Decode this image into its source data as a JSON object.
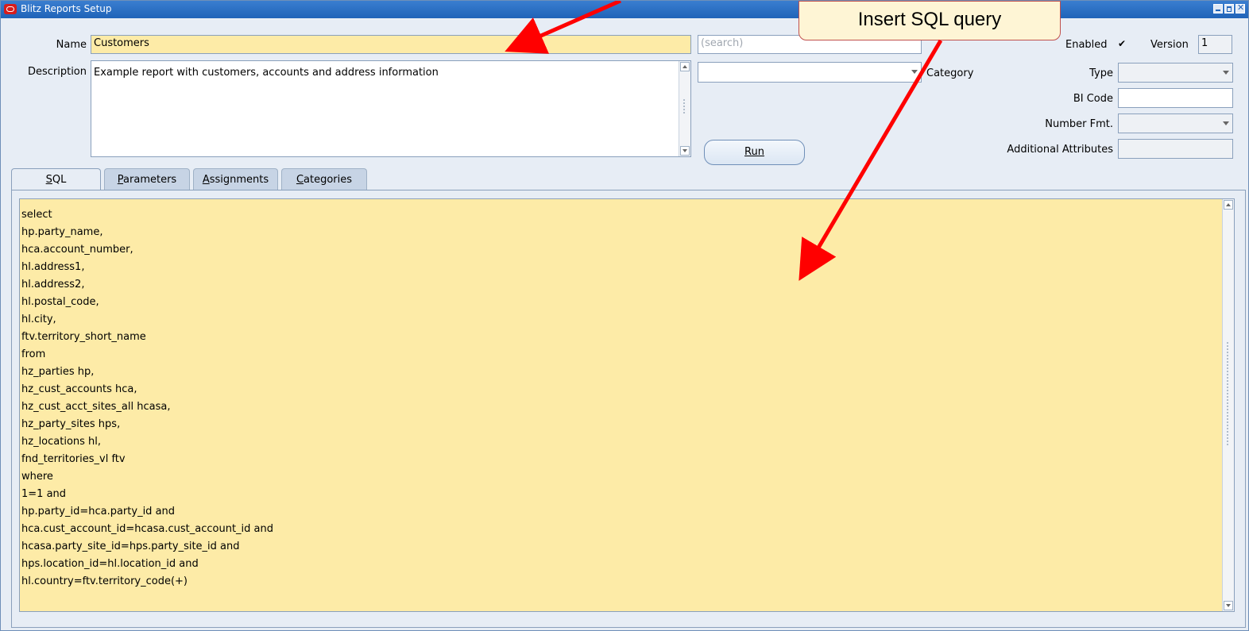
{
  "window": {
    "title": "Blitz Reports Setup",
    "icon": "oracle-app-icon",
    "controls": [
      "minimize-icon",
      "maximize-icon",
      "close-icon"
    ]
  },
  "form": {
    "name_label": "Name",
    "name_value": "Customers",
    "search_placeholder": "(search)",
    "description_label": "Description",
    "description_value": "Example report with customers, accounts and address information",
    "category_label": "Category",
    "category_value": "",
    "enabled_label": "Enabled",
    "enabled_checked": "✔",
    "version_label": "Version",
    "version_value": "1",
    "type_label": "Type",
    "type_value": "",
    "bi_code_label": "BI Code",
    "bi_code_value": "",
    "number_fmt_label": "Number Fmt.",
    "number_fmt_value": "",
    "additional_attributes_label": "Additional Attributes",
    "additional_attributes_value": "",
    "run_label": "Run"
  },
  "tabs": [
    {
      "label": "SQL",
      "mnemonic": "S",
      "rest": "QL",
      "active": true
    },
    {
      "label": "Parameters",
      "mnemonic": "P",
      "rest": "arameters",
      "active": false
    },
    {
      "label": "Assignments",
      "mnemonic": "A",
      "rest": "ssignments",
      "active": false
    },
    {
      "label": "Categories",
      "mnemonic": "C",
      "rest": "ategories",
      "active": false
    }
  ],
  "sql_lines": [
    "select",
    "hp.party_name,",
    "hca.account_number,",
    "hl.address1,",
    "hl.address2,",
    "hl.postal_code,",
    "hl.city,",
    "ftv.territory_short_name",
    "from",
    "hz_parties hp,",
    "hz_cust_accounts hca,",
    "hz_cust_acct_sites_all hcasa,",
    "hz_party_sites hps,",
    "hz_locations hl,",
    "fnd_territories_vl ftv",
    "where",
    "1=1 and",
    "hp.party_id=hca.party_id and",
    "hca.cust_account_id=hcasa.cust_account_id and",
    "hcasa.party_site_id=hps.party_site_id and",
    "hps.location_id=hl.location_id and",
    "hl.country=ftv.territory_code(+)"
  ],
  "annotation": {
    "callout_text": "Insert SQL query",
    "arrow_color": "#ff0000",
    "callout_border": "#c0504d"
  },
  "colors": {
    "title_bar": "#1f63b8",
    "field_highlight": "#fdeba7",
    "form_background": "#e7edf5"
  }
}
